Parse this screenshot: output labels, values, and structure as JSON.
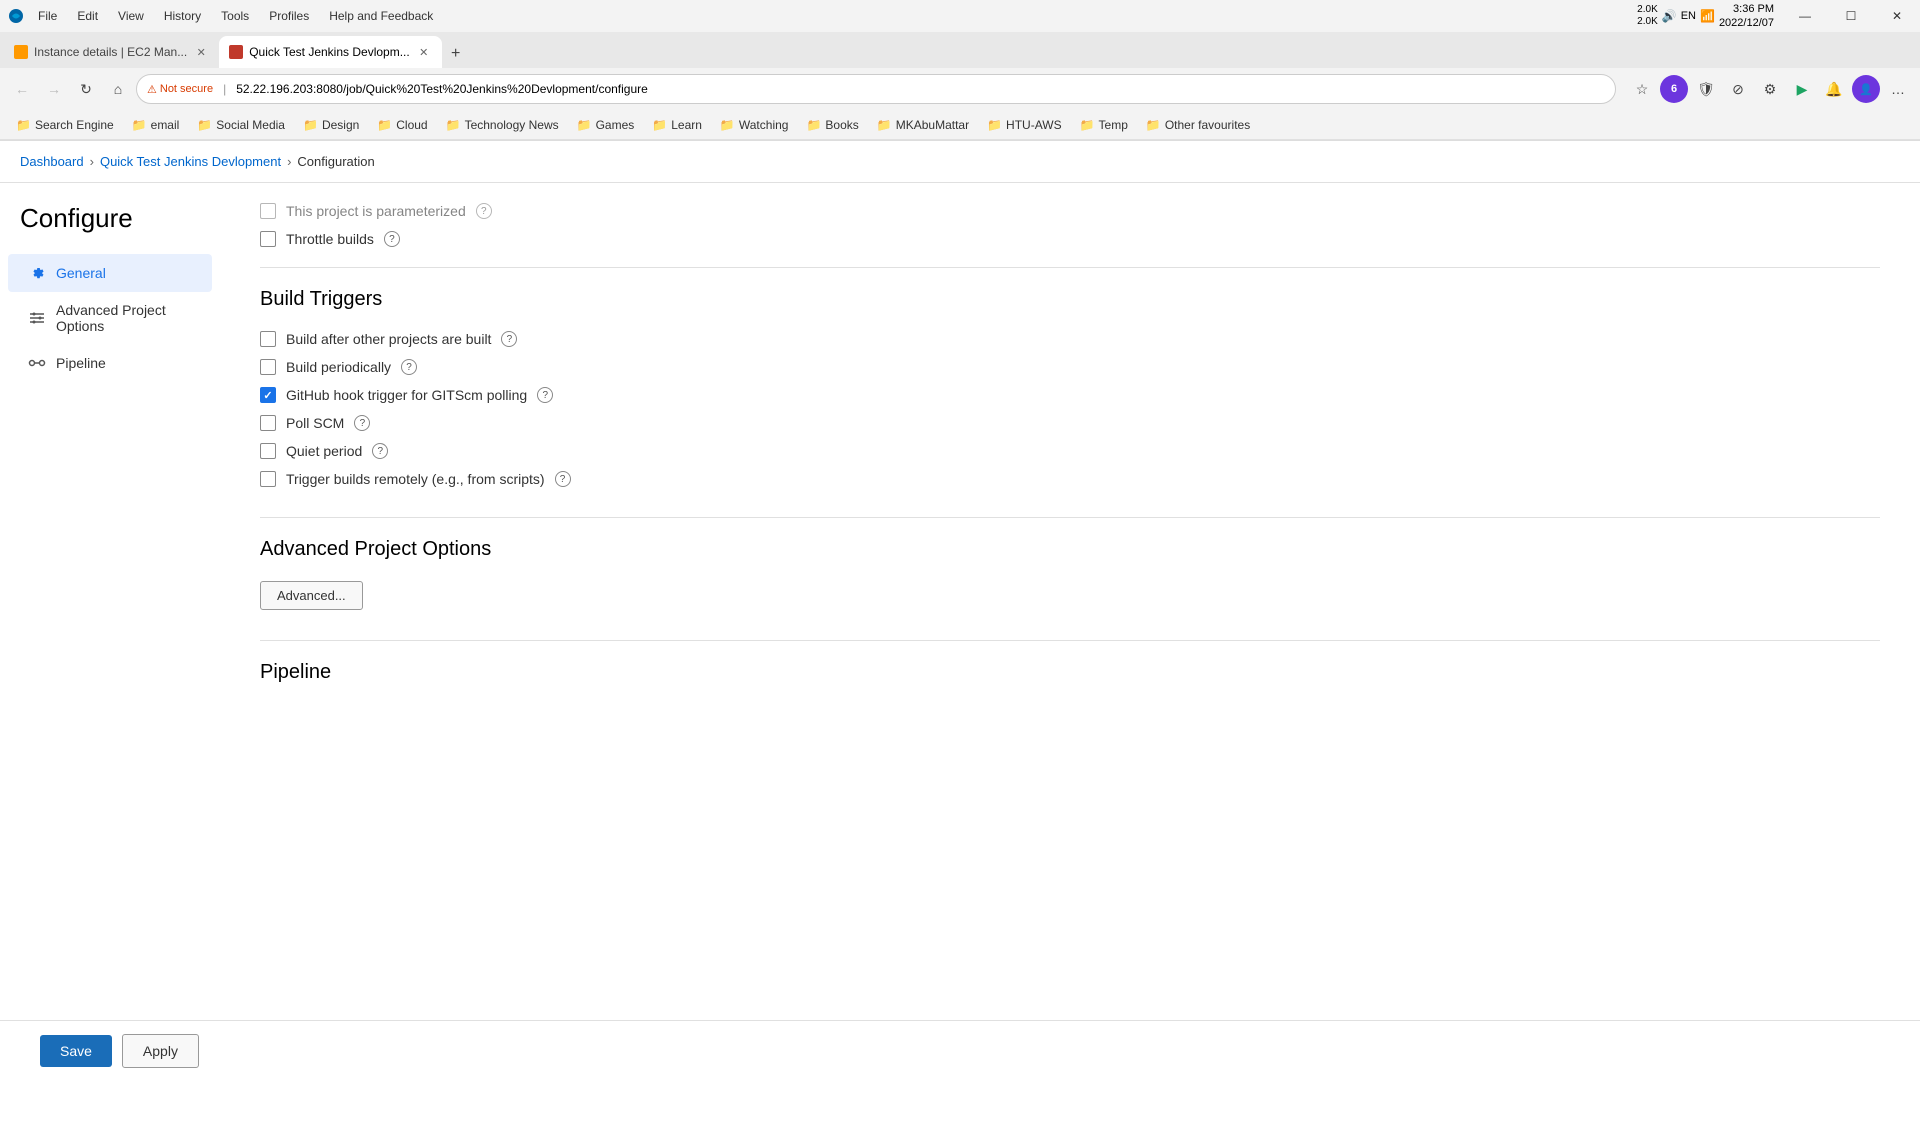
{
  "window": {
    "title": "Microsoft Edge",
    "menu_items": [
      "File",
      "Edit",
      "View",
      "History",
      "Tools",
      "Profiles",
      "Help and Feedback"
    ]
  },
  "tabs": [
    {
      "label": "Instance details | EC2 Man...",
      "active": false,
      "favicon_color": "#ff9900"
    },
    {
      "label": "Quick Test Jenkins Devlopm...",
      "active": true,
      "favicon_color": "#c0392b"
    }
  ],
  "address_bar": {
    "security_text": "Not secure",
    "url": "52.22.196.203:8080/job/Quick%20Test%20Jenkins%20Devlopment/configure"
  },
  "bookmarks": [
    "Search Engine",
    "email",
    "Social Media",
    "Design",
    "Cloud",
    "Technology News",
    "Games",
    "Learn",
    "Watching",
    "Books",
    "MKAbuMattar",
    "HTU-AWS",
    "Temp",
    "Other favourites"
  ],
  "breadcrumb": {
    "items": [
      "Dashboard",
      "Quick Test Jenkins Devlopment",
      "Configuration"
    ]
  },
  "sidebar": {
    "title": "Configure",
    "items": [
      {
        "label": "General",
        "active": true,
        "icon": "gear"
      },
      {
        "label": "Advanced Project Options",
        "active": false,
        "icon": "options"
      },
      {
        "label": "Pipeline",
        "active": false,
        "icon": "pipeline"
      }
    ]
  },
  "main": {
    "parameterized_label": "This project is parameterized",
    "throttle_builds_label": "Throttle builds",
    "build_triggers": {
      "section_title": "Build Triggers",
      "items": [
        {
          "label": "Build after other projects are built",
          "checked": false
        },
        {
          "label": "Build periodically",
          "checked": false
        },
        {
          "label": "GitHub hook trigger for GITScm polling",
          "checked": true
        },
        {
          "label": "Poll SCM",
          "checked": false
        },
        {
          "label": "Quiet period",
          "checked": false
        },
        {
          "label": "Trigger builds remotely (e.g., from scripts)",
          "checked": false
        }
      ]
    },
    "advanced_project_options": {
      "section_title": "Advanced Project Options",
      "button_label": "Advanced..."
    },
    "pipeline": {
      "section_title": "Pipeline"
    }
  },
  "actions": {
    "save_label": "Save",
    "apply_label": "Apply"
  },
  "system_tray": {
    "time": "3:36 PM",
    "date": "2022/12/07",
    "battery_text": "2.0K\n2.0K",
    "language": "EN"
  }
}
